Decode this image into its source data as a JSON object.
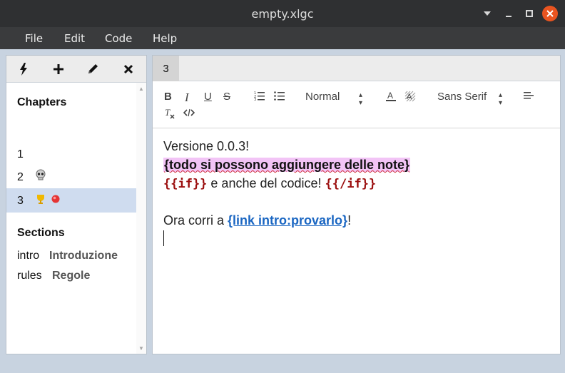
{
  "window": {
    "title": "empty.xlgc"
  },
  "menubar": {
    "items": [
      "File",
      "Edit",
      "Code",
      "Help"
    ]
  },
  "toolbar": {
    "icons": [
      "lightning-icon",
      "plus-icon",
      "pencil-icon",
      "close-icon"
    ]
  },
  "sidebar": {
    "chapters_heading": "Chapters",
    "chapters": [
      {
        "label": "1",
        "icons": []
      },
      {
        "label": "2",
        "icons": [
          "skull-icon"
        ]
      },
      {
        "label": "3",
        "icons": [
          "trophy-icon",
          "red-dot-icon"
        ],
        "selected": true
      }
    ],
    "sections_heading": "Sections",
    "sections": [
      {
        "key": "intro",
        "value": "Introduzione"
      },
      {
        "key": "rules",
        "value": "Regole"
      }
    ]
  },
  "tabs": [
    {
      "label": "3",
      "active": true
    }
  ],
  "editor_toolbar": {
    "header_select": "Normal",
    "font_select": "Sans Serif"
  },
  "editor": {
    "line1": "Versione 0.0.3!",
    "line2": "{todo si possono aggiungere delle note}",
    "line3_code_open": "{{if}}",
    "line3_text": " e anche del codice! ",
    "line3_code_close": "{{/if}}",
    "line4_prefix": "Ora corri a ",
    "line4_link": "{link intro:provarlo}",
    "line4_suffix": "!"
  },
  "colors": {
    "titlebar_bg": "#2f3032",
    "close_button": "#e95420",
    "selected_chapter_bg": "#cfdcef",
    "todo_highlight": "#f2c4f6",
    "code_color": "#9b0e0e",
    "link_color": "#1a66c2"
  }
}
